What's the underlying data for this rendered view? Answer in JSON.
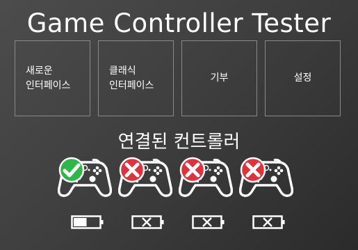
{
  "app": {
    "title": "Game Controller Tester"
  },
  "menu": {
    "tiles": [
      {
        "label": "새로운\n인터페이스"
      },
      {
        "label": "클래식\n인터페이스"
      },
      {
        "label": "기부"
      },
      {
        "label": "설정"
      }
    ]
  },
  "controllers": {
    "section_title": "연결된 컨트롤러",
    "slots": [
      {
        "connected": true,
        "status_icon": "check-icon",
        "battery": "battery-low-icon",
        "battery_level": 0.5
      },
      {
        "connected": false,
        "status_icon": "x-icon",
        "battery": "battery-none-icon"
      },
      {
        "connected": false,
        "status_icon": "x-icon",
        "battery": "battery-none-icon"
      },
      {
        "connected": false,
        "status_icon": "x-icon",
        "battery": "battery-none-icon"
      }
    ]
  },
  "colors": {
    "background": "#3f3f3f",
    "connected": "#2fb84a",
    "disconnected": "#e0323c",
    "foreground": "#ffffff"
  }
}
